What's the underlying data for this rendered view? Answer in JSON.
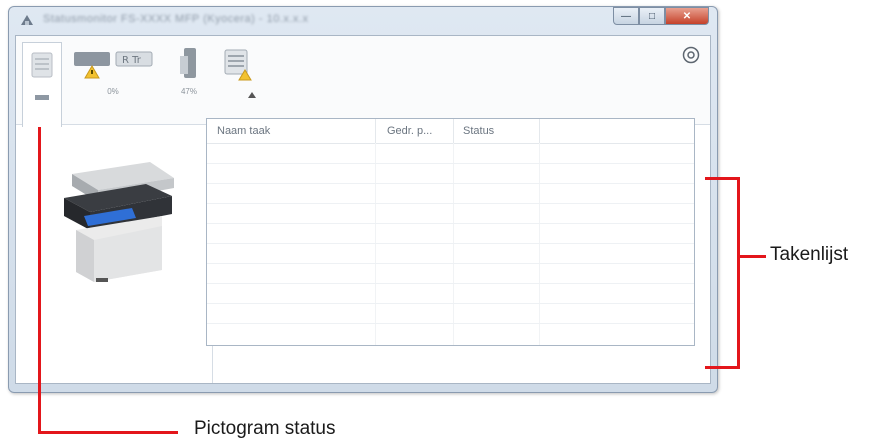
{
  "window": {
    "title": "Statusmonitor FS-XXXX MFP (Kyocera) - 10.x.x.x",
    "controls": {
      "minimize_glyph": "—",
      "maximize_glyph": "□",
      "close_glyph": "✕"
    }
  },
  "toolbar": {
    "tabs": [
      {
        "name": "printer-status",
        "icon": "printer-tab-icon",
        "percent": ""
      },
      {
        "name": "toner",
        "icon": "toner-warning-icon",
        "percent": "0%"
      },
      {
        "name": "paper",
        "icon": "paper-icon",
        "percent": "47%"
      },
      {
        "name": "job-alert",
        "icon": "job-alert-icon",
        "percent": ""
      }
    ],
    "settings_icon": "gear-icon"
  },
  "job_list": {
    "columns": [
      "Naam taak",
      "Gedr. p...",
      "Status"
    ],
    "rows": []
  },
  "annotations": {
    "job_list_label": "Takenlijst",
    "icon_status_label": "Pictogram status",
    "color": "#e3161b"
  }
}
